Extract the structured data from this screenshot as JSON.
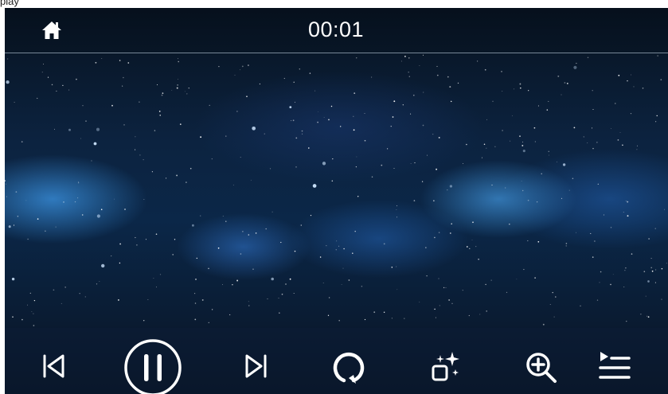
{
  "corner_label": "play",
  "topbar": {
    "time": "00:01",
    "home_icon": "home-icon"
  },
  "controls": [
    {
      "name": "previous-button",
      "icon": "skip-previous-icon"
    },
    {
      "name": "pause-button",
      "icon": "pause-icon"
    },
    {
      "name": "next-button",
      "icon": "skip-next-icon"
    },
    {
      "name": "repeat-button",
      "icon": "repeat-icon"
    },
    {
      "name": "effects-button",
      "icon": "sparkle-icon"
    },
    {
      "name": "zoom-button",
      "icon": "zoom-in-icon"
    },
    {
      "name": "playlist-button",
      "icon": "playlist-icon"
    }
  ],
  "colors": {
    "icon": "#ffffff",
    "background_dark": "#0a1c33",
    "nebula": "#3c96e6"
  }
}
